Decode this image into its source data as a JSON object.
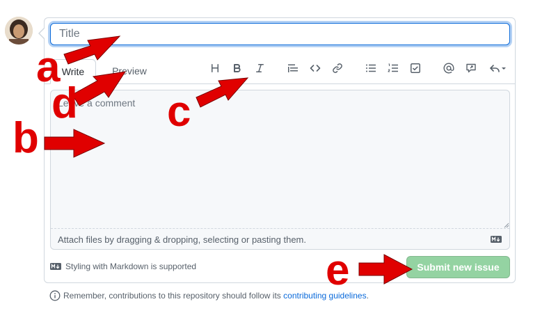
{
  "title_field": {
    "placeholder": "Title"
  },
  "tabs": [
    {
      "label": "Write"
    },
    {
      "label": "Preview"
    }
  ],
  "toolbar": [
    {
      "icon": "heading-icon"
    },
    {
      "icon": "bold-icon"
    },
    {
      "icon": "italic-icon"
    },
    {
      "icon": "quote-icon"
    },
    {
      "icon": "code-icon"
    },
    {
      "icon": "link-icon"
    },
    {
      "icon": "bulleted-list-icon"
    },
    {
      "icon": "numbered-list-icon"
    },
    {
      "icon": "task-list-icon"
    },
    {
      "icon": "mention-icon"
    },
    {
      "icon": "reference-icon"
    },
    {
      "icon": "saved-replies-icon"
    }
  ],
  "comment": {
    "placeholder": "Leave a comment"
  },
  "attach_hint": "Attach files by dragging & dropping, selecting or pasting them.",
  "styling_note": "Styling with Markdown is supported",
  "submit_label": "Submit new issue",
  "footer": {
    "prefix": "Remember, contributions to this repository should follow its ",
    "link": "contributing guidelines",
    "suffix": "."
  },
  "annotations": [
    {
      "letter": "a"
    },
    {
      "letter": "b"
    },
    {
      "letter": "c"
    },
    {
      "letter": "d"
    },
    {
      "letter": "e"
    }
  ],
  "colors": {
    "accent": "#0969da",
    "submit_disabled": "#94d3a2",
    "annotation": "#e00000"
  }
}
